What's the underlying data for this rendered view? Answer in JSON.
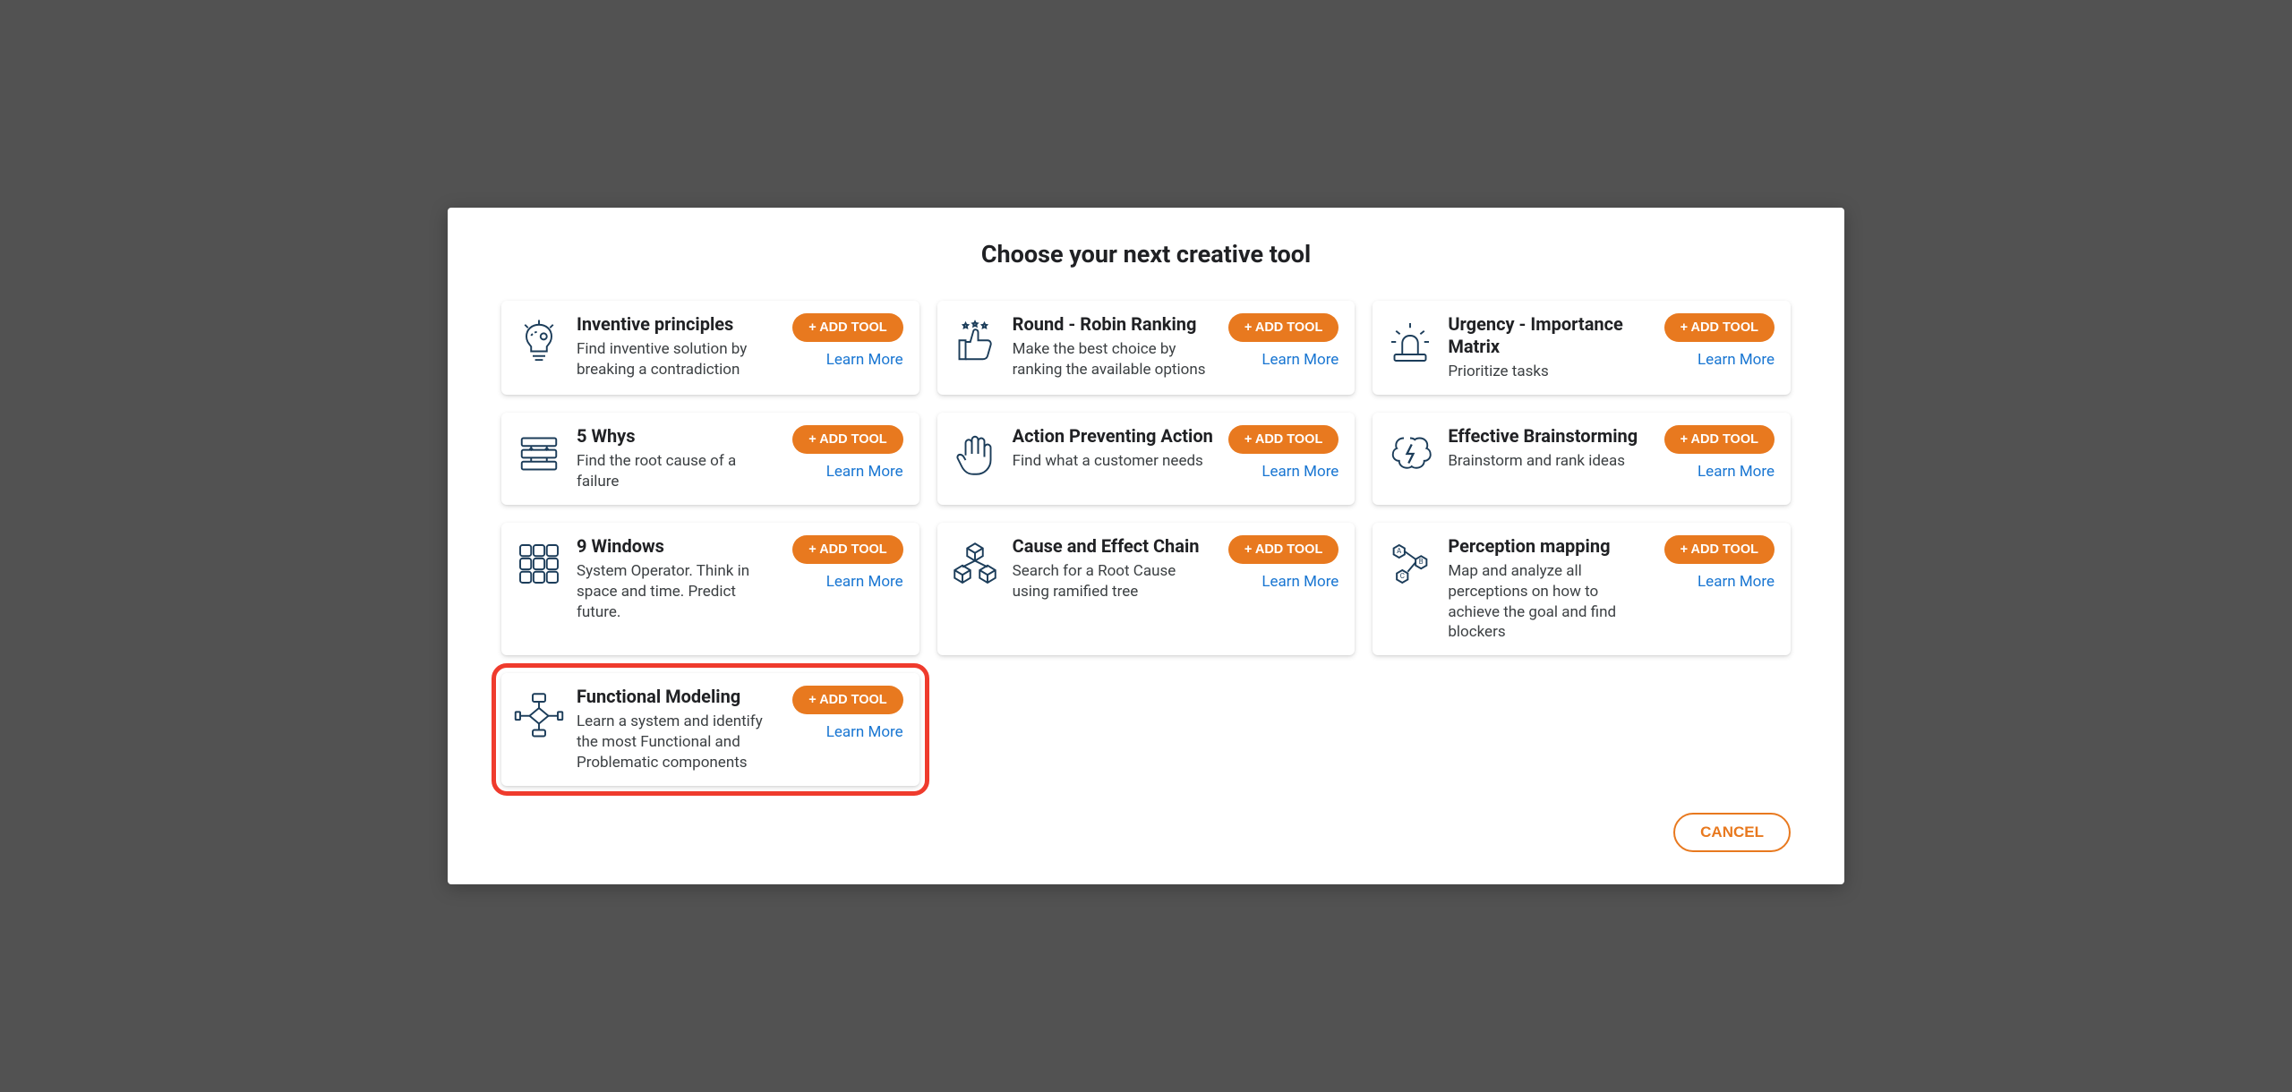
{
  "title": "Choose your next creative tool",
  "add_label": "+ ADD TOOL",
  "learn_label": "Learn More",
  "cancel_label": "CANCEL",
  "tools": [
    {
      "title": "Inventive principles",
      "desc": "Find inventive solution by breaking a contradiction"
    },
    {
      "title": "Round - Robin Ranking",
      "desc": "Make the best choice by ranking the available options"
    },
    {
      "title": "Urgency - Importance Matrix",
      "desc": "Prioritize tasks"
    },
    {
      "title": "5 Whys",
      "desc": "Find the root cause of a failure"
    },
    {
      "title": "Action Preventing Action",
      "desc": "Find what a customer needs"
    },
    {
      "title": "Effective Brainstorming",
      "desc": "Brainstorm and rank ideas"
    },
    {
      "title": "9 Windows",
      "desc": "System Operator. Think in space and time. Predict future."
    },
    {
      "title": "Cause and Effect Chain",
      "desc": "Search for a Root Cause using ramified tree"
    },
    {
      "title": "Perception mapping",
      "desc": "Map and analyze all perceptions on how to achieve the goal and find blockers"
    },
    {
      "title": "Functional Modeling",
      "desc": "Learn a system and identify the most Functional and Problematic components"
    }
  ],
  "highlighted_index": 9,
  "colors": {
    "accent": "#e8791f",
    "link": "#1976d2",
    "highlight": "#ef3b2d",
    "icon": "#1c3d5a"
  }
}
